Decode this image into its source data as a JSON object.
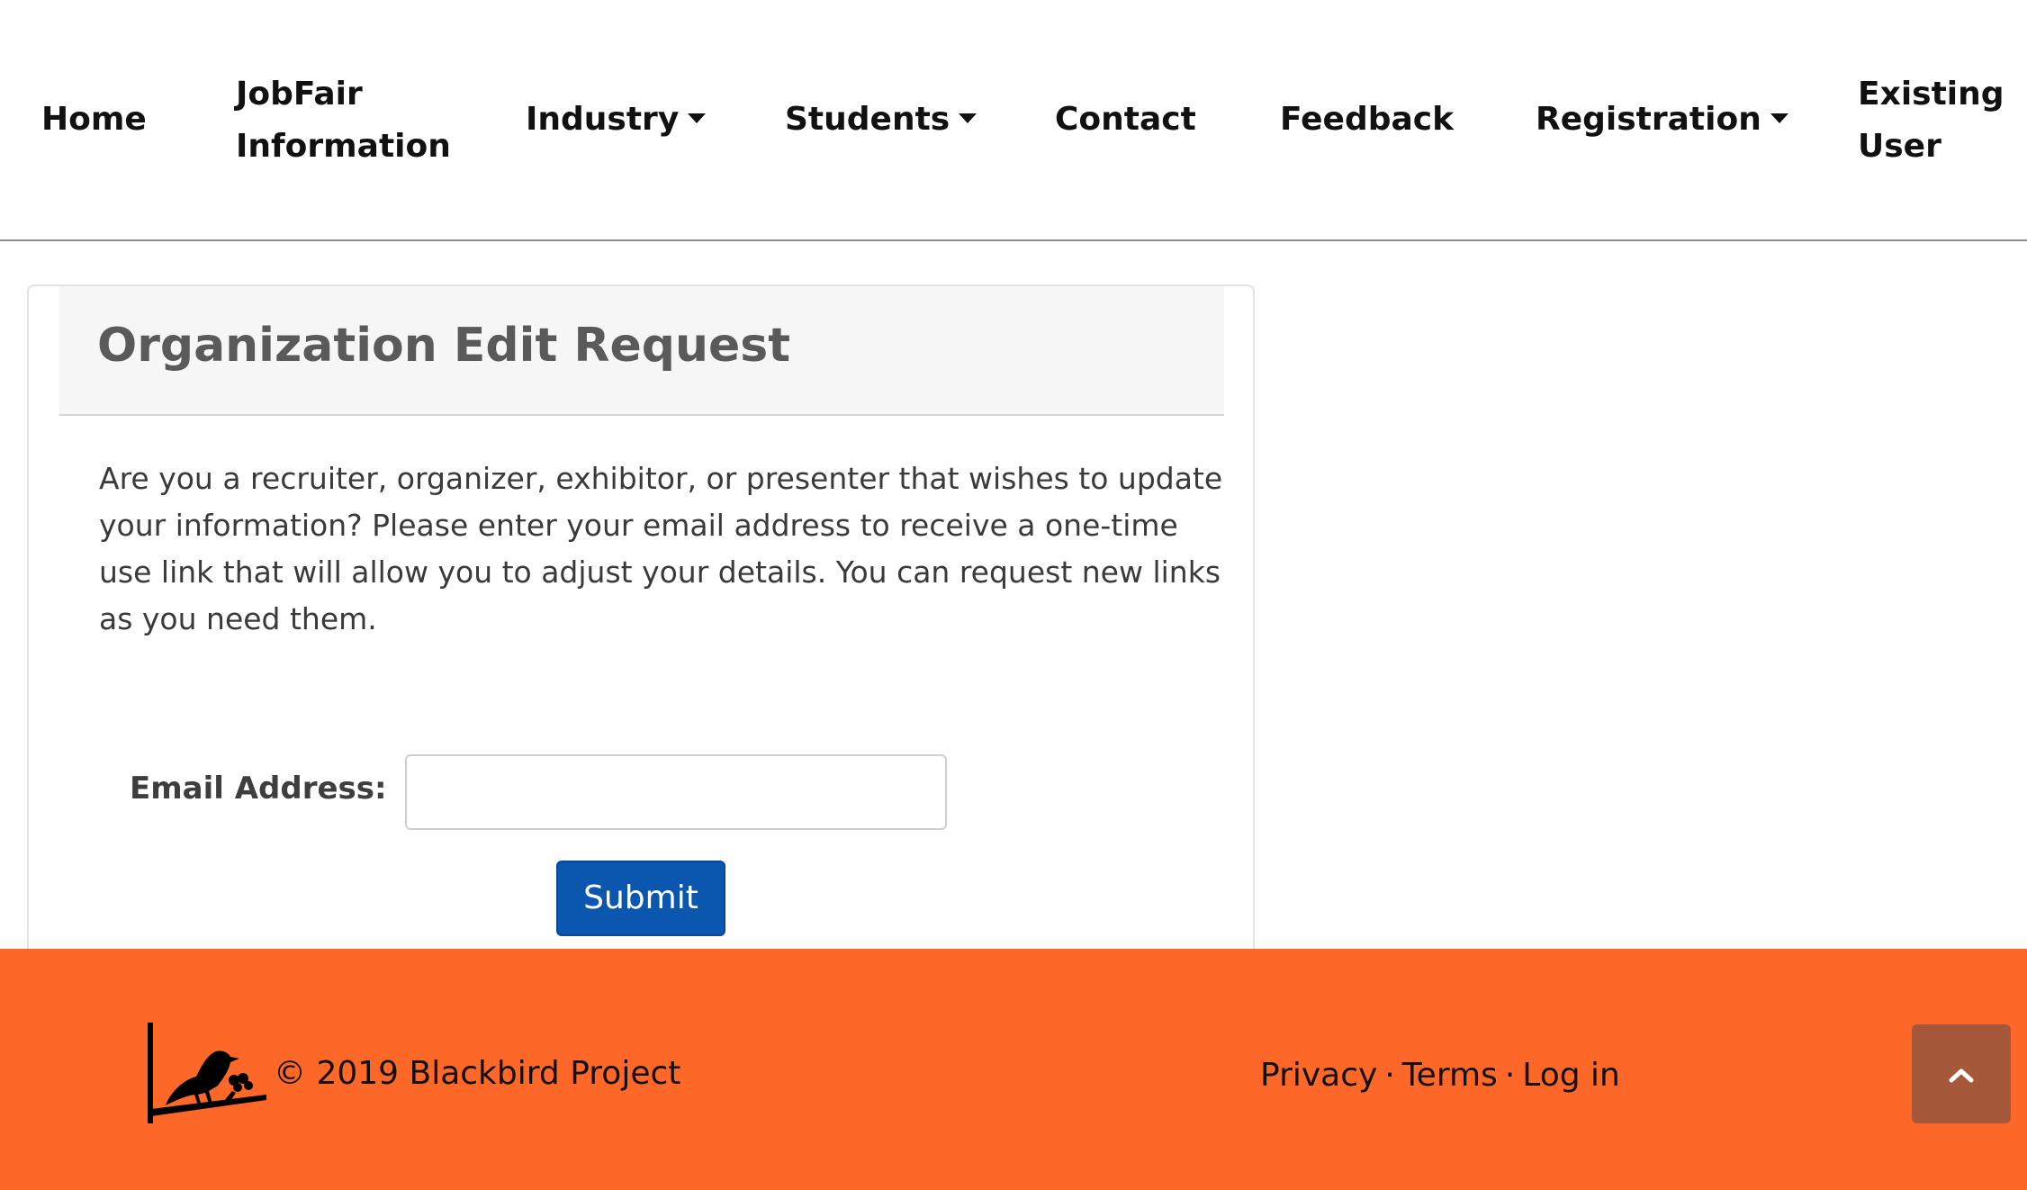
{
  "nav": {
    "home": "Home",
    "jobfair_line1": "JobFair",
    "jobfair_line2": "Information",
    "industry": "Industry",
    "students": "Students",
    "contact": "Contact",
    "feedback": "Feedback",
    "registration": "Registration",
    "existing_line1": "Existing",
    "existing_line2": "User"
  },
  "card": {
    "title": "Organization Edit Request",
    "description": "Are you a recruiter, organizer, exhibitor, or presenter that wishes to update your information? Please enter your email address to receive a one-time use link that will allow you to adjust your details. You can request new links as you need them.",
    "email_label": "Email Address:",
    "email_value": "",
    "submit_label": "Submit"
  },
  "footer": {
    "copyright": "© 2019 Blackbird Project",
    "privacy": "Privacy",
    "terms": "Terms",
    "login": "Log in",
    "separator": "·",
    "background_color": "#fd6727",
    "to_top_icon": "chevron-up-icon"
  },
  "colors": {
    "submit_button": "#0b56ae",
    "to_top_button": "#a5593a",
    "title_text": "#5a5a5a"
  }
}
